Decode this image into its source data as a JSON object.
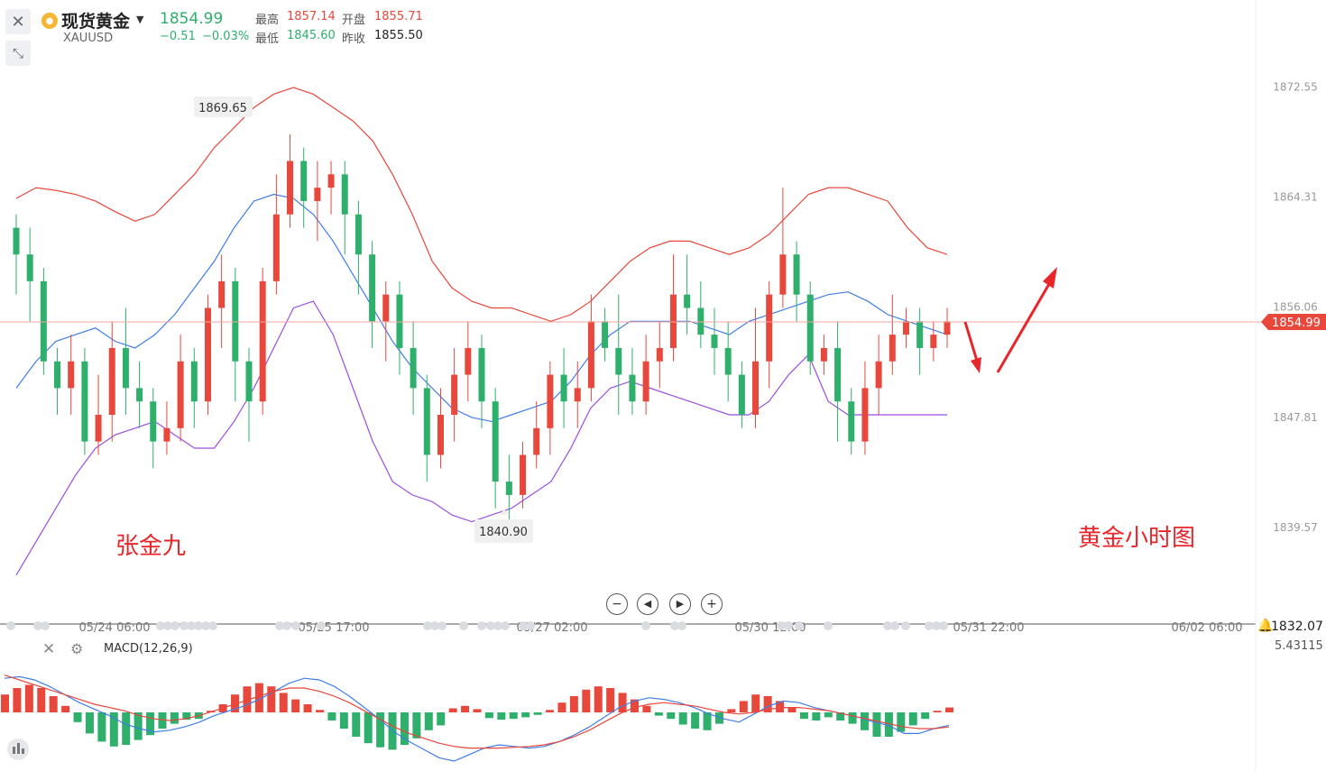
{
  "header": {
    "instrument": "现货黄金",
    "symbol": "XAUUSD",
    "price": "1854.99",
    "change": "−0.51",
    "change_pct": "−0.03%",
    "high_label": "最高",
    "high": "1857.14",
    "open_label": "开盘",
    "open": "1855.71",
    "low_label": "最低",
    "low": "1845.60",
    "prev_label": "昨收",
    "prev_close": "1855.50"
  },
  "annotations": {
    "author": "张金九",
    "chart_caption": "黄金小时图",
    "marker_high": "1869.65",
    "marker_low": "1840.90",
    "current_tag": "1854.99",
    "bottom_value": "1832.07"
  },
  "colors": {
    "up": "#e8473c",
    "down": "#2eaf6b",
    "mid_band": "#3f7ee8",
    "upper_band": "#e8473c",
    "lower_band": "#9b4ee0",
    "annotation": "#e8262a"
  },
  "chart_data": [
    {
      "type": "candlestick",
      "title": "",
      "indicator": "Bollinger Bands",
      "y_axis_ticks": [
        "1872.55",
        "1864.31",
        "1856.06",
        "1847.81",
        "1839.57"
      ],
      "ylim": [
        1834.5,
        1875.0
      ],
      "x_axis_ticks": [
        "05/24 06:00",
        "05/25 17:00",
        "05/27 02:00",
        "05/30 12:00",
        "05/31 22:00",
        "06/02 06:00"
      ],
      "candles": [
        [
          1862,
          1860,
          1863,
          1857
        ],
        [
          1860,
          1858,
          1862,
          1855
        ],
        [
          1858,
          1852,
          1859,
          1851
        ],
        [
          1852,
          1850,
          1853,
          1848
        ],
        [
          1850,
          1852,
          1854,
          1848
        ],
        [
          1852,
          1846,
          1853,
          1845
        ],
        [
          1846,
          1848,
          1851,
          1845
        ],
        [
          1848,
          1853,
          1855,
          1846
        ],
        [
          1853,
          1850,
          1856,
          1848
        ],
        [
          1850,
          1849,
          1852,
          1847
        ],
        [
          1849,
          1846,
          1850,
          1844
        ],
        [
          1846,
          1847,
          1849,
          1845
        ],
        [
          1847,
          1852,
          1854,
          1846
        ],
        [
          1852,
          1849,
          1853,
          1847
        ],
        [
          1849,
          1856,
          1857,
          1848
        ],
        [
          1856,
          1858,
          1860,
          1853
        ],
        [
          1858,
          1852,
          1859,
          1849
        ],
        [
          1852,
          1849,
          1853,
          1846
        ],
        [
          1849,
          1858,
          1859,
          1848
        ],
        [
          1858,
          1863,
          1866,
          1857
        ],
        [
          1863,
          1867,
          1869,
          1862
        ],
        [
          1867,
          1864,
          1868,
          1862
        ],
        [
          1864,
          1865,
          1867,
          1861
        ],
        [
          1865,
          1866,
          1867,
          1863
        ],
        [
          1866,
          1863,
          1867,
          1860
        ],
        [
          1863,
          1860,
          1864,
          1857
        ],
        [
          1860,
          1855,
          1861,
          1853
        ],
        [
          1855,
          1857,
          1858,
          1852
        ],
        [
          1857,
          1853,
          1858,
          1851
        ],
        [
          1853,
          1850,
          1855,
          1848
        ],
        [
          1850,
          1845,
          1851,
          1843
        ],
        [
          1845,
          1848,
          1850,
          1844
        ],
        [
          1848,
          1851,
          1853,
          1846
        ],
        [
          1851,
          1853,
          1855,
          1849
        ],
        [
          1853,
          1849,
          1854,
          1847
        ],
        [
          1849,
          1843,
          1850,
          1841
        ],
        [
          1843,
          1842,
          1845,
          1840
        ],
        [
          1842,
          1845,
          1846,
          1841
        ],
        [
          1845,
          1847,
          1849,
          1844
        ],
        [
          1847,
          1851,
          1852,
          1845
        ],
        [
          1851,
          1849,
          1853,
          1847
        ],
        [
          1849,
          1850,
          1852,
          1847
        ],
        [
          1850,
          1855,
          1857,
          1849
        ],
        [
          1855,
          1853,
          1856,
          1852
        ],
        [
          1853,
          1851,
          1857,
          1848
        ],
        [
          1851,
          1849,
          1853,
          1848
        ],
        [
          1849,
          1852,
          1854,
          1848
        ],
        [
          1852,
          1853,
          1855,
          1850
        ],
        [
          1853,
          1857,
          1860,
          1852
        ],
        [
          1857,
          1856,
          1860,
          1854
        ],
        [
          1856,
          1854,
          1858,
          1853
        ],
        [
          1854,
          1853,
          1856,
          1851
        ],
        [
          1853,
          1851,
          1855,
          1849
        ],
        [
          1851,
          1848,
          1852,
          1847
        ],
        [
          1848,
          1852,
          1856,
          1847
        ],
        [
          1852,
          1857,
          1858,
          1850
        ],
        [
          1857,
          1860,
          1865,
          1856
        ],
        [
          1860,
          1857,
          1861,
          1855
        ],
        [
          1857,
          1852,
          1858,
          1851
        ],
        [
          1852,
          1853,
          1854,
          1851
        ],
        [
          1853,
          1849,
          1855,
          1846
        ],
        [
          1849,
          1846,
          1850,
          1845
        ],
        [
          1846,
          1850,
          1852,
          1845
        ],
        [
          1850,
          1852,
          1854,
          1848
        ],
        [
          1852,
          1854,
          1857,
          1851
        ],
        [
          1854,
          1855,
          1856,
          1853
        ],
        [
          1855,
          1853,
          1856,
          1851
        ],
        [
          1853,
          1854,
          1855,
          1852
        ],
        [
          1854,
          1855,
          1856,
          1853
        ]
      ],
      "upper_band": [
        1864.2,
        1865.0,
        1864.8,
        1864.5,
        1864.0,
        1863.2,
        1862.5,
        1863.0,
        1864.5,
        1866.0,
        1868.0,
        1869.5,
        1871.0,
        1872.0,
        1872.5,
        1872.0,
        1871.0,
        1870.0,
        1868.5,
        1866.0,
        1863.0,
        1859.5,
        1857.5,
        1856.5,
        1856.0,
        1856.0,
        1855.5,
        1855.0,
        1855.5,
        1856.5,
        1858.0,
        1859.5,
        1860.5,
        1861.0,
        1861.0,
        1860.5,
        1860.0,
        1860.5,
        1861.5,
        1863.0,
        1864.5,
        1865.0,
        1865.0,
        1864.5,
        1864.0,
        1862.0,
        1860.5,
        1860.0
      ],
      "mid_band": [
        1850.0,
        1852.0,
        1853.5,
        1854.0,
        1854.5,
        1853.5,
        1853.0,
        1854.0,
        1855.5,
        1857.5,
        1859.5,
        1862.0,
        1864.0,
        1864.5,
        1864.2,
        1863.0,
        1861.0,
        1858.5,
        1856.0,
        1853.5,
        1851.5,
        1850.0,
        1848.5,
        1847.8,
        1847.5,
        1848.0,
        1848.5,
        1849.0,
        1850.5,
        1852.5,
        1854.0,
        1855.0,
        1855.0,
        1855.0,
        1855.0,
        1854.5,
        1854.0,
        1855.0,
        1855.5,
        1856.0,
        1856.5,
        1857.0,
        1857.2,
        1856.5,
        1855.5,
        1855.0,
        1854.5,
        1854.0
      ],
      "lower_band": [
        1836.0,
        1838.5,
        1841.0,
        1843.5,
        1845.5,
        1846.5,
        1847.0,
        1847.5,
        1846.5,
        1845.5,
        1845.5,
        1847.5,
        1850.0,
        1853.0,
        1856.0,
        1856.5,
        1854.0,
        1850.0,
        1846.0,
        1843.0,
        1842.0,
        1841.5,
        1840.5,
        1840.0,
        1840.5,
        1841.0,
        1842.0,
        1843.0,
        1845.5,
        1848.5,
        1850.0,
        1850.5,
        1850.0,
        1849.5,
        1849.0,
        1848.5,
        1848.0,
        1848.0,
        1849.0,
        1851.0,
        1852.5,
        1849.0,
        1848.0,
        1848.0,
        1848.0,
        1848.0,
        1848.0,
        1848.0
      ]
    },
    {
      "type": "bar",
      "title": "MACD(12,26,9)",
      "y_axis_ticks": [
        "5.43115"
      ],
      "histogram": [
        2.2,
        3.0,
        3.4,
        3.0,
        2.0,
        0.8,
        -1.2,
        -2.6,
        -3.6,
        -4.2,
        -4.0,
        -3.4,
        -2.8,
        -2.0,
        -1.4,
        -0.9,
        -0.8,
        0.2,
        1.0,
        2.2,
        3.2,
        3.6,
        3.2,
        2.4,
        1.6,
        1.0,
        0.3,
        -1.0,
        -2.0,
        -3.0,
        -3.8,
        -4.3,
        -4.6,
        -4.0,
        -3.2,
        -2.2,
        -1.6,
        0.5,
        0.8,
        0.4,
        -0.7,
        -0.9,
        -0.8,
        -0.6,
        -0.3,
        0.3,
        1.2,
        2.0,
        2.8,
        3.2,
        3.0,
        2.4,
        1.6,
        0.8,
        -0.4,
        -0.8,
        -1.5,
        -2.0,
        -2.2,
        -1.4,
        0.4,
        1.4,
        2.2,
        2.0,
        1.4,
        0.6,
        -0.8,
        -1.0,
        -0.6,
        -1.0,
        -1.4,
        -2.2,
        -3.0,
        -3.0,
        -2.4,
        -1.6,
        -0.8,
        0.2,
        0.6
      ],
      "dif": [
        4.2,
        4.4,
        4.0,
        3.2,
        2.2,
        1.2,
        0.4,
        -0.4,
        -1.4,
        -2.0,
        -2.4,
        -2.2,
        -1.8,
        -1.2,
        -0.4,
        0.2,
        0.8,
        1.6,
        2.6,
        3.6,
        4.2,
        4.0,
        3.2,
        2.0,
        0.6,
        -0.8,
        -2.4,
        -3.6,
        -4.6,
        -5.6,
        -6.0,
        -5.2,
        -4.4,
        -4.0,
        -4.2,
        -4.4,
        -4.2,
        -3.6,
        -2.8,
        -1.8,
        -0.6,
        0.6,
        1.4,
        1.8,
        1.6,
        1.2,
        0.6,
        -0.2,
        -0.8,
        -1.2,
        -0.2,
        0.8,
        1.4,
        1.2,
        0.6,
        0.2,
        -0.2,
        -0.6,
        -1.2,
        -1.6,
        -2.6,
        -2.6,
        -2.0,
        -1.6
      ],
      "dea": [
        4.6,
        4.0,
        3.4,
        2.8,
        2.2,
        1.6,
        1.0,
        0.6,
        0.2,
        -0.4,
        -0.8,
        -1.0,
        -0.8,
        -0.4,
        0.2,
        0.8,
        1.4,
        2.0,
        2.6,
        3.0,
        3.0,
        2.6,
        2.0,
        1.2,
        0.2,
        -0.8,
        -1.8,
        -2.6,
        -3.2,
        -3.8,
        -4.2,
        -4.4,
        -4.4,
        -4.4,
        -4.3,
        -4.2,
        -4.0,
        -3.6,
        -3.0,
        -2.2,
        -1.2,
        -0.2,
        0.6,
        1.0,
        1.2,
        1.0,
        0.8,
        0.4,
        0.0,
        -0.2,
        0.0,
        0.4,
        0.6,
        0.6,
        0.4,
        0.2,
        -0.2,
        -0.6,
        -1.0,
        -1.4,
        -1.8,
        -2.0,
        -2.0,
        -1.8
      ]
    }
  ]
}
